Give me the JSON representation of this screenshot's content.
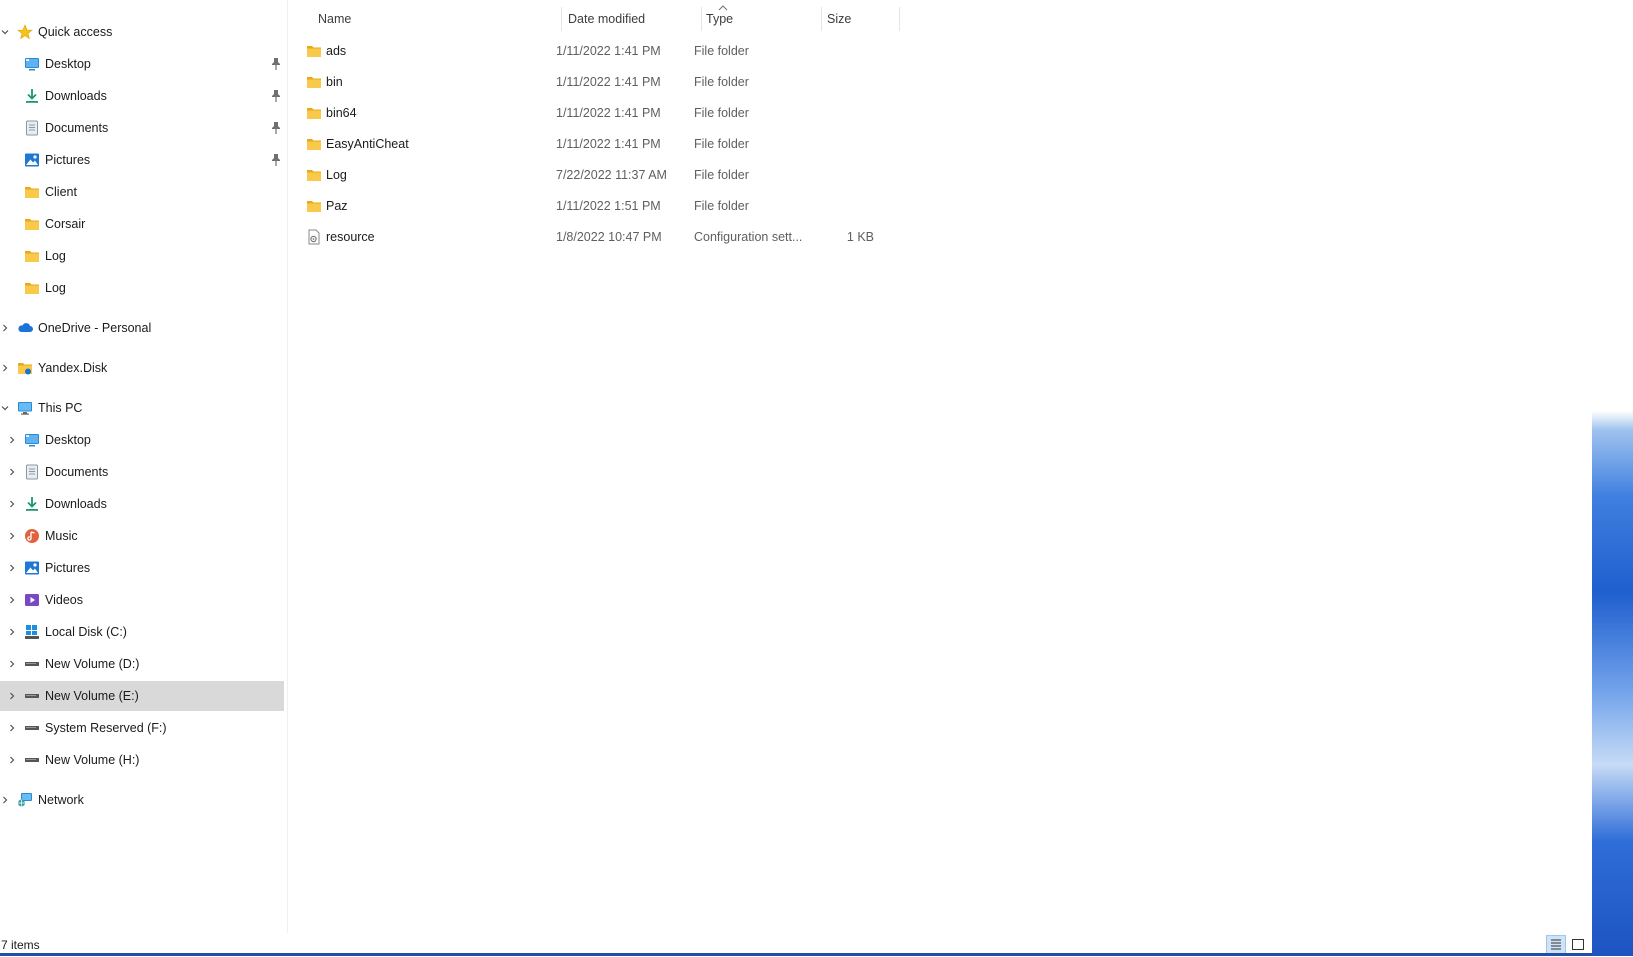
{
  "nav": {
    "quick_access": {
      "label": "Quick access",
      "items": [
        {
          "label": "Desktop",
          "icon": "desktop-icon",
          "pinned": true
        },
        {
          "label": "Downloads",
          "icon": "downloads-icon",
          "pinned": true
        },
        {
          "label": "Documents",
          "icon": "documents-icon",
          "pinned": true
        },
        {
          "label": "Pictures",
          "icon": "pictures-icon",
          "pinned": true
        },
        {
          "label": "Client",
          "icon": "folder-icon",
          "pinned": false
        },
        {
          "label": "Corsair",
          "icon": "folder-icon",
          "pinned": false
        },
        {
          "label": "Log",
          "icon": "folder-icon",
          "pinned": false
        },
        {
          "label": "Log",
          "icon": "folder-icon",
          "pinned": false
        }
      ]
    },
    "onedrive": {
      "label": "OneDrive - Personal"
    },
    "yandex": {
      "label": "Yandex.Disk"
    },
    "this_pc": {
      "label": "This PC",
      "items": [
        {
          "label": "Desktop",
          "icon": "desktop-icon"
        },
        {
          "label": "Documents",
          "icon": "documents-icon"
        },
        {
          "label": "Downloads",
          "icon": "downloads-icon"
        },
        {
          "label": "Music",
          "icon": "music-icon"
        },
        {
          "label": "Pictures",
          "icon": "pictures-icon"
        },
        {
          "label": "Videos",
          "icon": "videos-icon"
        },
        {
          "label": "Local Disk (C:)",
          "icon": "windows-drive-icon"
        },
        {
          "label": "New Volume (D:)",
          "icon": "drive-icon"
        },
        {
          "label": "New Volume (E:)",
          "icon": "drive-icon",
          "selected": true
        },
        {
          "label": "System Reserved (F:)",
          "icon": "drive-icon"
        },
        {
          "label": "New Volume (H:)",
          "icon": "drive-icon"
        }
      ]
    },
    "network": {
      "label": "Network"
    }
  },
  "columns": {
    "name": "Name",
    "date": "Date modified",
    "type": "Type",
    "size": "Size"
  },
  "files": [
    {
      "name": "ads",
      "date": "1/11/2022 1:41 PM",
      "type": "File folder",
      "size": "",
      "icon": "folder-icon"
    },
    {
      "name": "bin",
      "date": "1/11/2022 1:41 PM",
      "type": "File folder",
      "size": "",
      "icon": "folder-icon"
    },
    {
      "name": "bin64",
      "date": "1/11/2022 1:41 PM",
      "type": "File folder",
      "size": "",
      "icon": "folder-icon"
    },
    {
      "name": "EasyAntiCheat",
      "date": "1/11/2022 1:41 PM",
      "type": "File folder",
      "size": "",
      "icon": "folder-icon"
    },
    {
      "name": "Log",
      "date": "7/22/2022 11:37 AM",
      "type": "File folder",
      "size": "",
      "icon": "folder-icon"
    },
    {
      "name": "Paz",
      "date": "1/11/2022 1:51 PM",
      "type": "File folder",
      "size": "",
      "icon": "folder-icon"
    },
    {
      "name": "resource",
      "date": "1/8/2022 10:47 PM",
      "type": "Configuration sett...",
      "size": "1 KB",
      "icon": "config-file-icon"
    }
  ],
  "status": {
    "item_count": "7 items"
  },
  "colors": {
    "folder": "#f5c542",
    "selection": "#d9d9d9",
    "accent": "#0067c0"
  }
}
